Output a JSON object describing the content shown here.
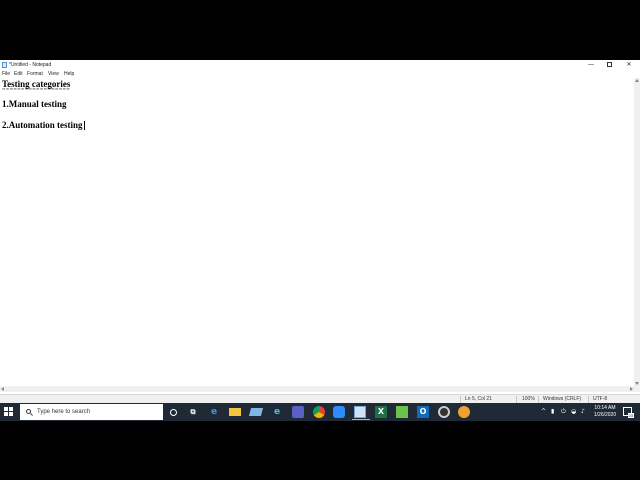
{
  "window": {
    "title": "*Untitled - Notepad",
    "controls": {
      "minimize": "—",
      "close": "✕"
    }
  },
  "menu": {
    "items": [
      "File",
      "Edit",
      "Format",
      "View",
      "Help"
    ]
  },
  "document": {
    "lines": [
      "Testing categories",
      "==================",
      "1.Manual testing",
      "",
      "2.Automation testing"
    ]
  },
  "status": {
    "position": "Ln 5, Col 21",
    "zoom": "100%",
    "line_ending": "Windows (CRLF)",
    "encoding": "UTF-8"
  },
  "taskbar": {
    "search_placeholder": "Type here to search",
    "pinned_icons": [
      "cortana-icon",
      "task-view-icon",
      "edge-legacy-icon",
      "file-explorer-icon",
      "paint-icon",
      "ie-icon",
      "teams-icon",
      "chrome-icon",
      "zoom-icon",
      "notepad-icon",
      "excel-icon",
      "file-icon",
      "outlook-icon",
      "camera-icon",
      "app-icon"
    ],
    "clock_time": "10:14 AM",
    "clock_date": "1/26/2020",
    "notification_count": "23"
  },
  "colors": {
    "taskbar_bg": "#202a36",
    "editor_bg": "#ffffff",
    "excel": "#1e7145",
    "outlook": "#0f6cbd",
    "zoom": "#2d8cff",
    "explorer": "#f5c242",
    "chrome_red": "#db4437"
  }
}
